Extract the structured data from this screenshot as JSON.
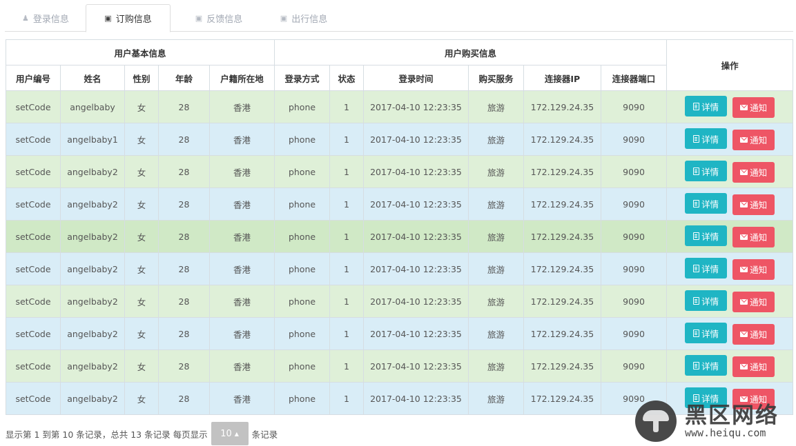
{
  "tabs": [
    {
      "label": "登录信息",
      "icon": "user-icon",
      "active": false
    },
    {
      "label": "订购信息",
      "icon": "briefcase-icon",
      "active": true
    },
    {
      "label": "反馈信息",
      "icon": "briefcase-icon",
      "active": false
    },
    {
      "label": "出行信息",
      "icon": "briefcase-icon",
      "active": false
    }
  ],
  "table": {
    "group_headers": {
      "basic": "用户基本信息",
      "purchase": "用户购买信息",
      "actions": "操作"
    },
    "columns": [
      "用户编号",
      "姓名",
      "性别",
      "年龄",
      "户籍所在地",
      "登录方式",
      "状态",
      "登录时间",
      "购买服务",
      "连接器IP",
      "连接器端口"
    ],
    "detail_label": "详情",
    "notify_label": "通知",
    "rows": [
      [
        "setCode",
        "angelbaby",
        "女",
        "28",
        "香港",
        "phone",
        "1",
        "2017-04-10 12:23:35",
        "旅游",
        "172.129.24.35",
        "9090"
      ],
      [
        "setCode",
        "angelbaby1",
        "女",
        "28",
        "香港",
        "phone",
        "1",
        "2017-04-10 12:23:35",
        "旅游",
        "172.129.24.35",
        "9090"
      ],
      [
        "setCode",
        "angelbaby2",
        "女",
        "28",
        "香港",
        "phone",
        "1",
        "2017-04-10 12:23:35",
        "旅游",
        "172.129.24.35",
        "9090"
      ],
      [
        "setCode",
        "angelbaby2",
        "女",
        "28",
        "香港",
        "phone",
        "1",
        "2017-04-10 12:23:35",
        "旅游",
        "172.129.24.35",
        "9090"
      ],
      [
        "setCode",
        "angelbaby2",
        "女",
        "28",
        "香港",
        "phone",
        "1",
        "2017-04-10 12:23:35",
        "旅游",
        "172.129.24.35",
        "9090"
      ],
      [
        "setCode",
        "angelbaby2",
        "女",
        "28",
        "香港",
        "phone",
        "1",
        "2017-04-10 12:23:35",
        "旅游",
        "172.129.24.35",
        "9090"
      ],
      [
        "setCode",
        "angelbaby2",
        "女",
        "28",
        "香港",
        "phone",
        "1",
        "2017-04-10 12:23:35",
        "旅游",
        "172.129.24.35",
        "9090"
      ],
      [
        "setCode",
        "angelbaby2",
        "女",
        "28",
        "香港",
        "phone",
        "1",
        "2017-04-10 12:23:35",
        "旅游",
        "172.129.24.35",
        "9090"
      ],
      [
        "setCode",
        "angelbaby2",
        "女",
        "28",
        "香港",
        "phone",
        "1",
        "2017-04-10 12:23:35",
        "旅游",
        "172.129.24.35",
        "9090"
      ],
      [
        "setCode",
        "angelbaby2",
        "女",
        "28",
        "香港",
        "phone",
        "1",
        "2017-04-10 12:23:35",
        "旅游",
        "172.129.24.35",
        "9090"
      ]
    ],
    "row_styles": [
      "green",
      "blue",
      "green",
      "blue",
      "hl",
      "blue",
      "green",
      "blue",
      "green",
      "blue"
    ]
  },
  "pagination": {
    "summary": "显示第 1 到第 10 条记录，总共 13 条记录 每页显示",
    "page_size": "10",
    "suffix": "条记录"
  },
  "watermark": {
    "text_cn": "黑区网络",
    "url": "www.heiqu.com"
  },
  "colors": {
    "row_green": "#dff0d8",
    "row_blue": "#d9edf7",
    "row_highlight": "#d0e9c6",
    "btn_info": "#1fb5c4",
    "btn_danger": "#ee5565",
    "pager_bg": "#c2c2c2"
  }
}
